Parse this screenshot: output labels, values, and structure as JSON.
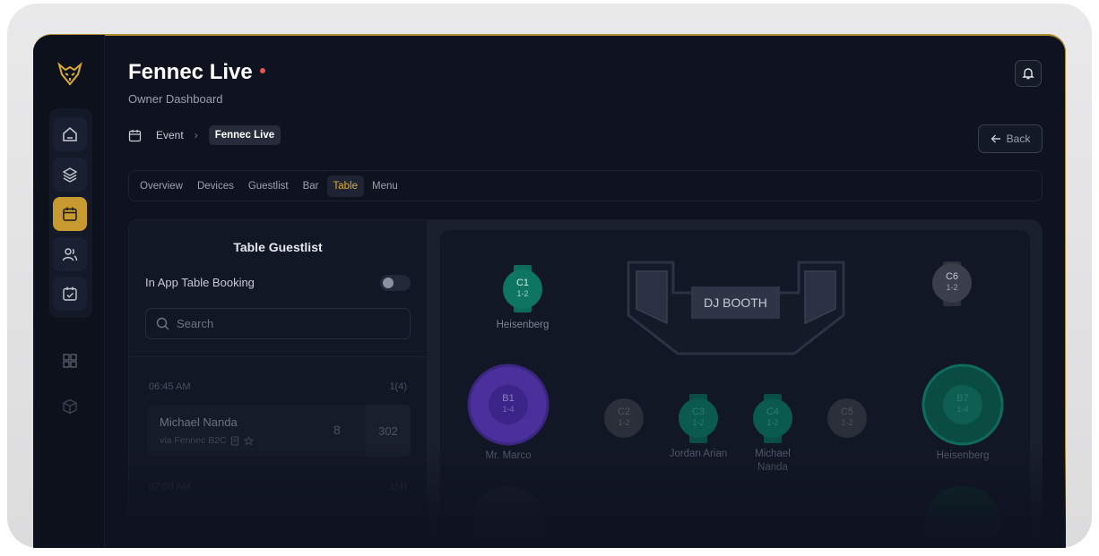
{
  "app": {
    "title": "Fennec Live",
    "subtitle": "Owner Dashboard"
  },
  "breadcrumb": {
    "root": "Event",
    "current": "Fennec Live"
  },
  "back_label": "Back",
  "tabs": [
    "Overview",
    "Devices",
    "Guestlist",
    "Bar",
    "Table",
    "Menu"
  ],
  "active_tab": "Table",
  "guestlist": {
    "title": "Table Guestlist",
    "booking_label": "In App Table Booking",
    "search_placeholder": "Search",
    "groups": [
      {
        "time": "06:45 AM",
        "count": "1(4)"
      },
      {
        "time": "07:00 AM",
        "count": "1(4)"
      }
    ],
    "guest": {
      "name": "Michael Nanda",
      "via": "via Fennec B2C",
      "count": "8",
      "table": "302"
    }
  },
  "floor": {
    "dj_booth": "DJ BOOTH",
    "tables": [
      {
        "id": "C1",
        "cap": "1-2",
        "guest": "Heisenberg",
        "state": "occupied"
      },
      {
        "id": "C6",
        "cap": "1-2",
        "guest": "",
        "state": "free"
      },
      {
        "id": "B1",
        "cap": "1-4",
        "guest": "Mr. Marco",
        "state": "vip"
      },
      {
        "id": "C2",
        "cap": "1-2",
        "guest": "",
        "state": "free"
      },
      {
        "id": "C3",
        "cap": "1-2",
        "guest": "Jordan Arian",
        "state": "occupied"
      },
      {
        "id": "C4",
        "cap": "1-2",
        "guest": "Michael Nanda",
        "state": "occupied"
      },
      {
        "id": "C5",
        "cap": "1-2",
        "guest": "",
        "state": "free"
      },
      {
        "id": "B7",
        "cap": "1-4",
        "guest": "Heisenberg",
        "state": "occupied"
      }
    ]
  },
  "colors": {
    "accent": "#c79a2f",
    "occupied": "#0e6b5c",
    "vip": "#4b2f9a",
    "free": "#3a3f4b",
    "live": "#e45454"
  }
}
